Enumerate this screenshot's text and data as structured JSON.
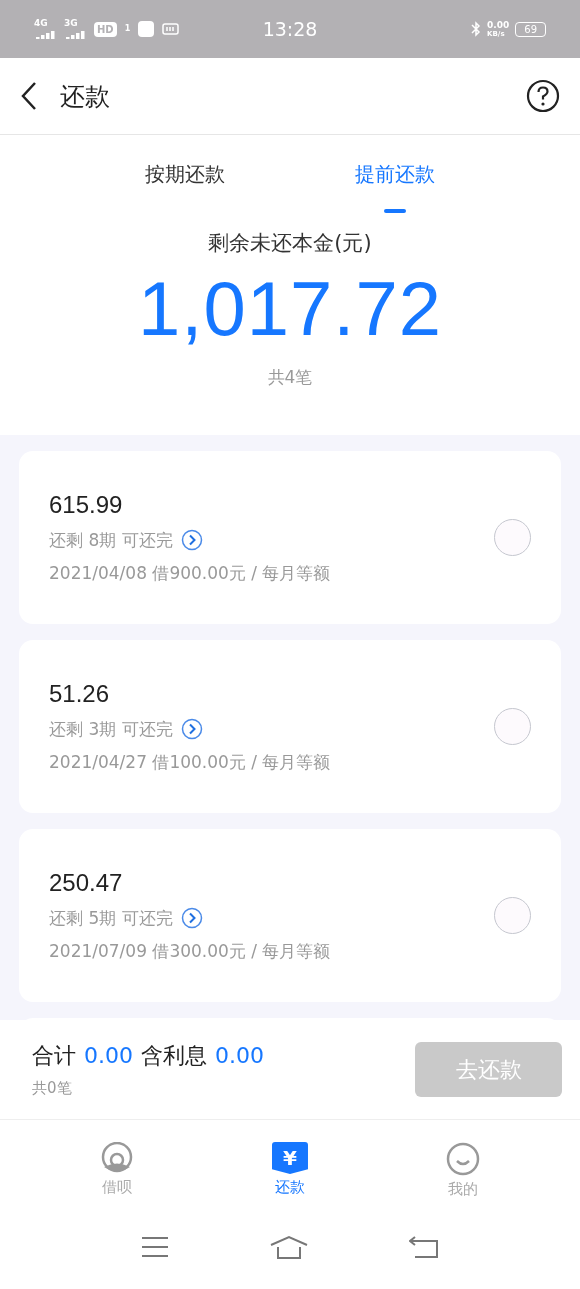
{
  "status_bar": {
    "signal_1": "4G",
    "signal_2": "3G",
    "hd": "HD",
    "hd_sub": "1",
    "time": "13:28",
    "speed": "0.00",
    "speed_unit": "KB/s",
    "battery": "69"
  },
  "header": {
    "title": "还款"
  },
  "tabs": [
    {
      "label": "按期还款",
      "selected": false
    },
    {
      "label": "提前还款",
      "selected": true
    }
  ],
  "summary": {
    "label": "剩余未还本金(元)",
    "amount": "1,017.72",
    "count": "共4笔"
  },
  "loans": [
    {
      "amount": "615.99",
      "remaining": "还剩 8期 可还完",
      "detail": "2021/04/08 借900.00元 / 每月等额",
      "selected": false
    },
    {
      "amount": "51.26",
      "remaining": "还剩 3期 可还完",
      "detail": "2021/04/27 借100.00元 / 每月等额",
      "selected": false
    },
    {
      "amount": "250.47",
      "remaining": "还剩 5期 可还完",
      "detail": "2021/07/09 借300.00元 / 每月等额",
      "selected": false
    }
  ],
  "total": {
    "label": "合计",
    "amount": "0.00",
    "interest_label": "含利息",
    "interest": "0.00",
    "count": "共0笔",
    "button": "去还款",
    "disabled": true
  },
  "nav": [
    {
      "kind": "borrow",
      "label": "借呗",
      "selected": false
    },
    {
      "kind": "repay",
      "label": "还款",
      "glyph": "¥",
      "selected": true
    },
    {
      "kind": "mine",
      "label": "我的",
      "selected": false
    }
  ]
}
